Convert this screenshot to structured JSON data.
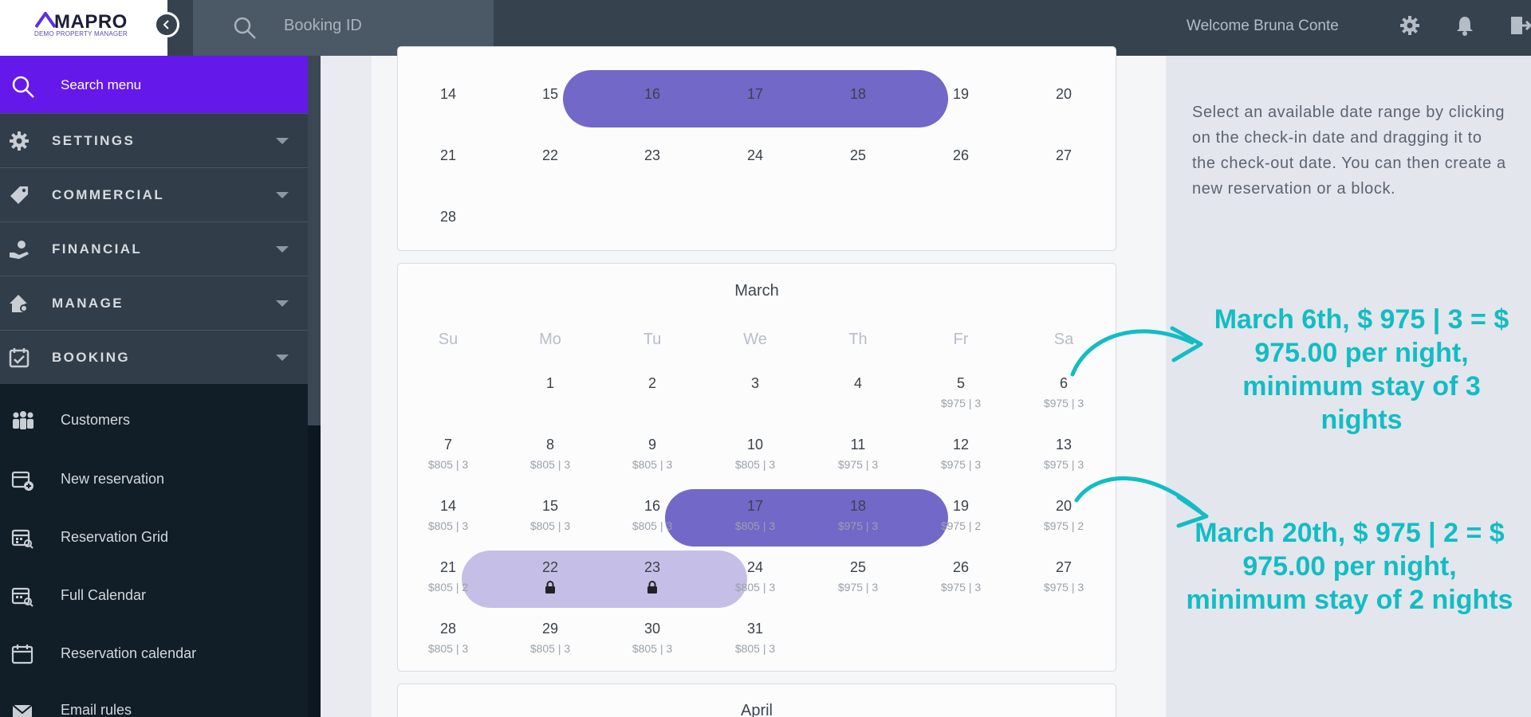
{
  "brand": {
    "name": "MAPRO",
    "tagline": "DEMO PROPERTY MANAGER"
  },
  "topbar": {
    "search_placeholder": "Booking ID",
    "welcome": "Welcome Bruna Conte",
    "icons": [
      "collapse-sidebar-icon",
      "search-icon",
      "gear-icon",
      "bell-icon",
      "logout-icon"
    ]
  },
  "sidebar": {
    "search_label": "Search menu",
    "sections": [
      {
        "label": "SETTINGS",
        "icon": "gear-icon"
      },
      {
        "label": "COMMERCIAL",
        "icon": "tag-icon"
      },
      {
        "label": "FINANCIAL",
        "icon": "hand-coin-icon"
      },
      {
        "label": "MANAGE",
        "icon": "house-gear-icon"
      },
      {
        "label": "BOOKING",
        "icon": "calendar-check-icon"
      }
    ],
    "booking_items": [
      {
        "label": "Customers",
        "icon": "people-icon"
      },
      {
        "label": "New reservation",
        "icon": "calendar-add-icon"
      },
      {
        "label": "Reservation Grid",
        "icon": "calendar-grid-icon"
      },
      {
        "label": "Full Calendar",
        "icon": "calendar-search-icon"
      },
      {
        "label": "Reservation calendar",
        "icon": "calendar-icon"
      },
      {
        "label": "Email rules",
        "icon": "envelope-icon"
      }
    ]
  },
  "calendar": {
    "february_partial": {
      "weeks": [
        [
          "14",
          "15",
          "16",
          "17",
          "18",
          "19",
          "20"
        ],
        [
          "21",
          "22",
          "23",
          "24",
          "25",
          "26",
          "27"
        ],
        [
          "28",
          "",
          "",
          "",
          "",
          "",
          ""
        ]
      ],
      "selected_range": [
        "16",
        "17",
        "18"
      ]
    },
    "march": {
      "title": "March",
      "weekdays": [
        "Su",
        "Mo",
        "Tu",
        "We",
        "Th",
        "Fr",
        "Sa"
      ],
      "weeks": [
        [
          null,
          {
            "d": "1"
          },
          {
            "d": "2"
          },
          {
            "d": "3"
          },
          {
            "d": "4"
          },
          {
            "d": "5",
            "p": "$975 | 3"
          },
          {
            "d": "6",
            "p": "$975 | 3"
          }
        ],
        [
          {
            "d": "7",
            "p": "$805 | 3"
          },
          {
            "d": "8",
            "p": "$805 | 3"
          },
          {
            "d": "9",
            "p": "$805 | 3"
          },
          {
            "d": "10",
            "p": "$805 | 3"
          },
          {
            "d": "11",
            "p": "$975 | 3"
          },
          {
            "d": "12",
            "p": "$975 | 3"
          },
          {
            "d": "13",
            "p": "$975 | 3"
          }
        ],
        [
          {
            "d": "14",
            "p": "$805 | 3"
          },
          {
            "d": "15",
            "p": "$805 | 3"
          },
          {
            "d": "16",
            "p": "$805 | 3"
          },
          {
            "d": "17",
            "p": "$805 | 3"
          },
          {
            "d": "18",
            "p": "$975 | 3"
          },
          {
            "d": "19",
            "p": "$975 | 2"
          },
          {
            "d": "20",
            "p": "$975 | 2"
          }
        ],
        [
          {
            "d": "21",
            "p": "$805 | 2"
          },
          {
            "d": "22",
            "lock": true
          },
          {
            "d": "23",
            "lock": true
          },
          {
            "d": "24",
            "p": "$805 | 3"
          },
          {
            "d": "25",
            "p": "$975 | 3"
          },
          {
            "d": "26",
            "p": "$975 | 3"
          },
          {
            "d": "27",
            "p": "$975 | 3"
          }
        ],
        [
          {
            "d": "28",
            "p": "$805 | 3"
          },
          {
            "d": "29",
            "p": "$805 | 3"
          },
          {
            "d": "30",
            "p": "$805 | 3"
          },
          {
            "d": "31",
            "p": "$805 | 3"
          },
          null,
          null,
          null
        ]
      ],
      "selected_range": [
        "17",
        "18"
      ],
      "blocked_range": [
        "22",
        "23"
      ]
    },
    "next_month_title": "April"
  },
  "help_text": "Select an available date range by clicking on the check-in date and dragging it to the check-out date. You can then create a new reservation or a block.",
  "annotations": [
    {
      "text": "March 6th, $ 975 | 3 = $ 975.00 per night, minimum stay of 3 nights"
    },
    {
      "text": "March 20th, $ 975 | 2 = $ 975.00 per night, minimum stay of 2 nights"
    }
  ],
  "colors": {
    "accent_purple": "#6419ea",
    "range_selected": "#7268c8",
    "range_blocked": "#c5bfe7",
    "annotation_teal": "#13bcc4",
    "topbar": "#36434e",
    "sidebar": "#111d27"
  }
}
